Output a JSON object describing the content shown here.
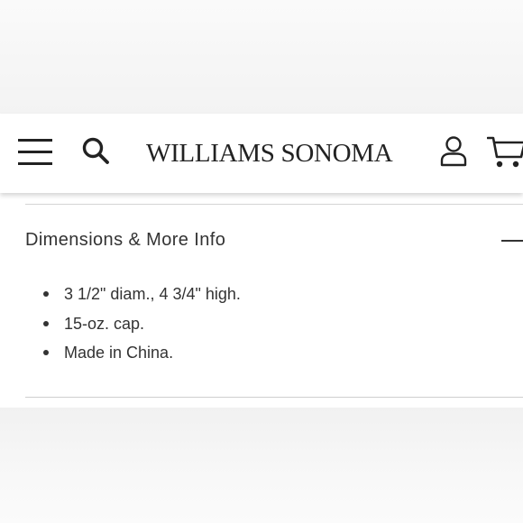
{
  "header": {
    "brand": "WILLIAMS SONOMA",
    "icons": {
      "menu": "hamburger-menu-icon",
      "search": "search-icon",
      "account": "account-icon",
      "cart": "cart-icon"
    },
    "icon_color": "#222222"
  },
  "section": {
    "title": "Dimensions & More Info",
    "expanded": true,
    "toggle_icon": "minus-icon",
    "items": [
      "3 1/2\" diam., 4 3/4\" high.",
      "15-oz. cap.",
      "Made in China."
    ]
  },
  "colors": {
    "text": "#333333",
    "divider": "#d4d4d4",
    "page_background": "#f6f6f6"
  }
}
